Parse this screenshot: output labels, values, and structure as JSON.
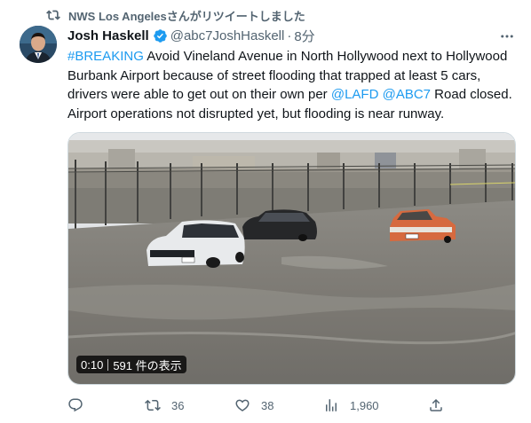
{
  "retweet": {
    "icon": "retweet-icon",
    "text": "NWS Los Angelesさんがリツイートしました"
  },
  "author": {
    "name": "Josh Haskell",
    "handle": "@abc7JoshHaskell",
    "separator": "·",
    "time": "8分",
    "verified_icon": "verified-badge-icon",
    "avatar_icon": "avatar"
  },
  "tweet": {
    "hashtag": "#BREAKING",
    "body_1": " Avoid Vineland Avenue in North Hollywood next to Hollywood Burbank Airport because of street flooding that trapped at least 5 cars, drivers were able to get out on their own per ",
    "mention_1": "@LAFD",
    "space": " ",
    "mention_2": "@ABC7",
    "body_2": " Road closed. Airport operations not disrupted yet, but flooding is near runway."
  },
  "video": {
    "duration": "0:10",
    "views": "591 件の表示"
  },
  "actions": {
    "reply_icon": "reply-icon",
    "retweet_icon": "retweet-icon",
    "retweet_count": "36",
    "like_icon": "heart-icon",
    "like_count": "38",
    "analytics_icon": "analytics-icon",
    "analytics_count": "1,960",
    "share_icon": "share-icon"
  },
  "colors": {
    "link": "#1d9bf0",
    "secondary_text": "#536471",
    "verified": "#1d9bf0"
  }
}
